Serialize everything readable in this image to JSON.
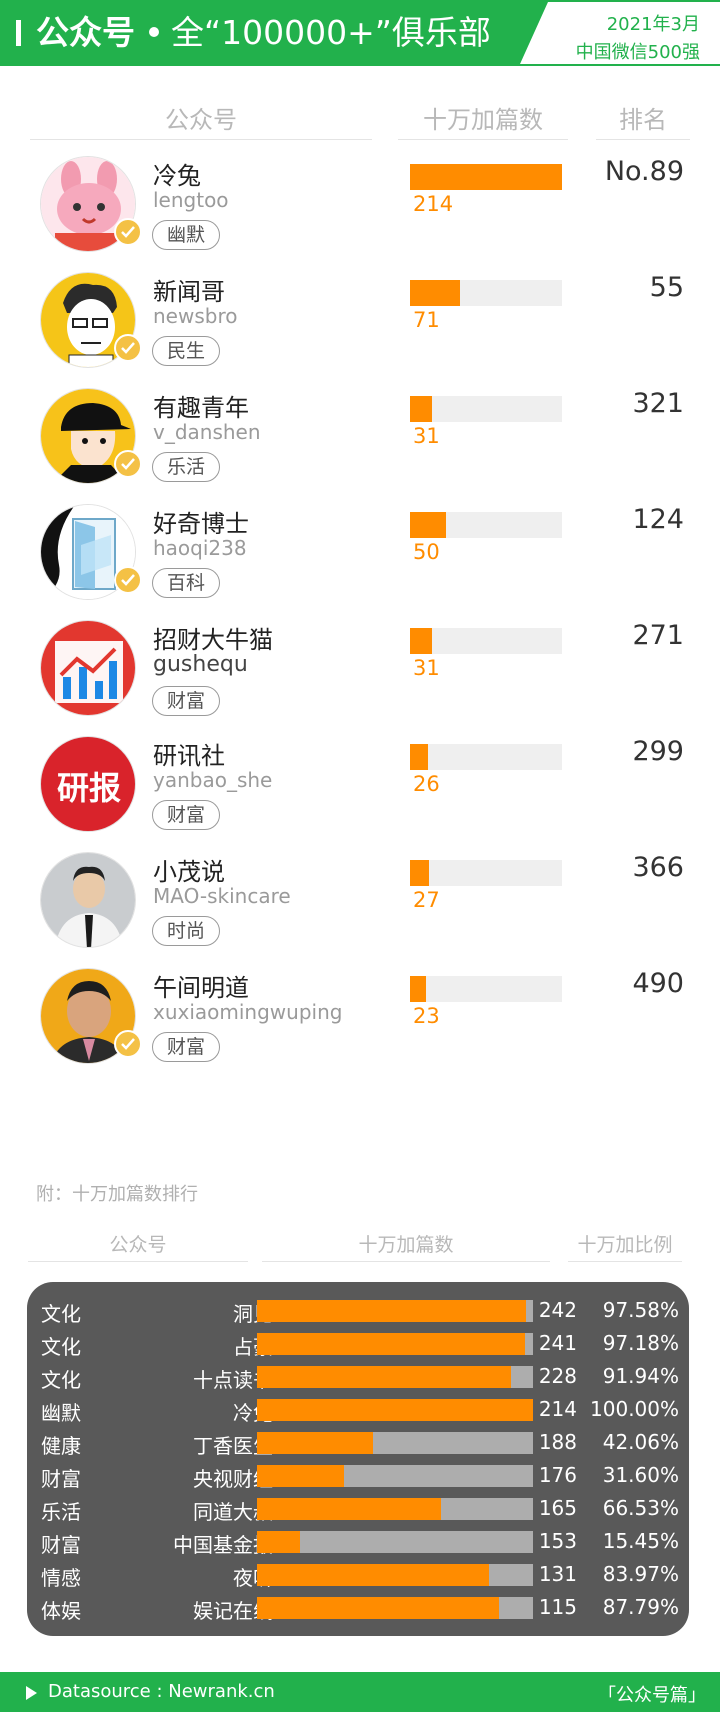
{
  "header": {
    "bar": "I",
    "title_bold": "公众号",
    "title_rest": "全“100000+”俱乐部",
    "date": "2021年3月",
    "subtitle": "中国微信500强"
  },
  "table_headers": {
    "account": "公众号",
    "count": "十万加篇数",
    "rank": "排名"
  },
  "accounts": [
    {
      "name": "冷兔",
      "id": "lengtoo",
      "tag": "幽默",
      "count": "214",
      "count_value": 214,
      "rank": "No.89",
      "avatar": "rabbit-avatar",
      "verified": true
    },
    {
      "name": "新闻哥",
      "id": "newsbro",
      "tag": "民生",
      "count": "71",
      "count_value": 71,
      "rank": "55",
      "avatar": "cartoon-man-avatar",
      "verified": true
    },
    {
      "name": "有趣青年",
      "id": "v_danshen",
      "tag": "乐活",
      "count": "31",
      "count_value": 31,
      "rank": "321",
      "avatar": "cap-boy-avatar",
      "verified": true
    },
    {
      "name": "好奇博士",
      "id": "haoqi238",
      "tag": "百科",
      "count": "50",
      "count_value": 50,
      "rank": "124",
      "avatar": "door-avatar",
      "verified": true
    },
    {
      "name": "招财大牛猫",
      "id": "gushequ",
      "tag": "财富",
      "count": "31",
      "count_value": 31,
      "rank": "271",
      "avatar": "stock-chart-avatar",
      "verified": false
    },
    {
      "name": "研讯社",
      "id": "yanbao_she",
      "tag": "财富",
      "count": "26",
      "count_value": 26,
      "rank": "299",
      "avatar_text": "研报",
      "avatar": "yanbao-logo-avatar",
      "verified": false
    },
    {
      "name": "小茂说",
      "id": "MAO-skincare",
      "tag": "时尚",
      "count": "27",
      "count_value": 27,
      "rank": "366",
      "avatar": "man-photo-avatar",
      "verified": false
    },
    {
      "name": "午间明道",
      "id": "xuxiaomingwuping",
      "tag": "财富",
      "count": "23",
      "count_value": 23,
      "rank": "490",
      "avatar": "man-portrait-avatar",
      "verified": true
    }
  ],
  "appendix": {
    "note": "附：十万加篇数排行",
    "headers": {
      "account": "公众号",
      "count": "十万加篇数",
      "ratio": "十万加比例"
    },
    "rows": [
      {
        "category": "文化",
        "name": "洞见",
        "count": "242",
        "ratio": "97.58%",
        "ratio_value": 0.9758
      },
      {
        "category": "文化",
        "name": "占豪",
        "count": "241",
        "ratio": "97.18%",
        "ratio_value": 0.9718
      },
      {
        "category": "文化",
        "name": "十点读书",
        "count": "228",
        "ratio": "91.94%",
        "ratio_value": 0.9194
      },
      {
        "category": "幽默",
        "name": "冷兔",
        "count": "214",
        "ratio": "100.00%",
        "ratio_value": 1.0
      },
      {
        "category": "健康",
        "name": "丁香医生",
        "count": "188",
        "ratio": "42.06%",
        "ratio_value": 0.4206
      },
      {
        "category": "财富",
        "name": "央视财经",
        "count": "176",
        "ratio": "31.60%",
        "ratio_value": 0.316
      },
      {
        "category": "乐活",
        "name": "同道大叔",
        "count": "165",
        "ratio": "66.53%",
        "ratio_value": 0.6653
      },
      {
        "category": "财富",
        "name": "中国基金报",
        "count": "153",
        "ratio": "15.45%",
        "ratio_value": 0.1545
      },
      {
        "category": "情感",
        "name": "夜听",
        "count": "131",
        "ratio": "83.97%",
        "ratio_value": 0.8397
      },
      {
        "category": "体娱",
        "name": "娱记在线",
        "count": "115",
        "ratio": "87.79%",
        "ratio_value": 0.8779
      }
    ]
  },
  "footer": {
    "source": "Datasource : Newrank.cn",
    "brand": "「公众号篇」"
  },
  "colors": {
    "green": "#22b14c",
    "orange": "#ff8c00",
    "panel": "#595959",
    "bar_track": "#efefef",
    "verify": "#f4c145"
  }
}
